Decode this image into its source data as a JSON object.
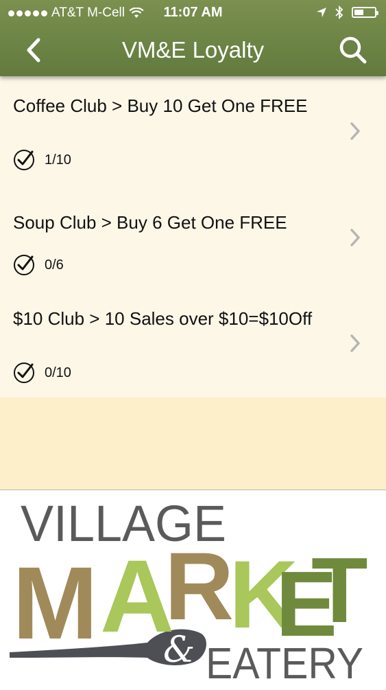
{
  "status_bar": {
    "carrier": "AT&T M-Cell",
    "time": "11:07 AM",
    "battery_level": 0.45
  },
  "nav": {
    "title": "VM&E Loyalty",
    "back_icon": "chevron-left-icon",
    "search_icon": "search-icon"
  },
  "items": [
    {
      "title": "Coffee Club > Buy 10 Get One FREE",
      "progress": "1/10"
    },
    {
      "title": "Soup Club > Buy 6 Get One FREE",
      "progress": "0/6"
    },
    {
      "title": "$10 Club > 10 Sales over $10=$10Off",
      "progress": "0/10"
    }
  ],
  "logo": {
    "line1": "VILLAGE",
    "line2_letters": [
      "M",
      "A",
      "R",
      "K",
      "E",
      "T"
    ],
    "line3_amp": "&",
    "line3": "EATERY",
    "colors": {
      "village": "#5a5a5a",
      "tan": "#a18a5a",
      "light_green": "#a9c75a",
      "dark_green": "#6f8a3c",
      "spoon": "#4d4f55"
    }
  },
  "colors": {
    "nav_green": "#6c8445",
    "list_bg": "#fdf7e8",
    "filler_bg": "#fcefc9",
    "chevron": "#b5b5b5"
  }
}
